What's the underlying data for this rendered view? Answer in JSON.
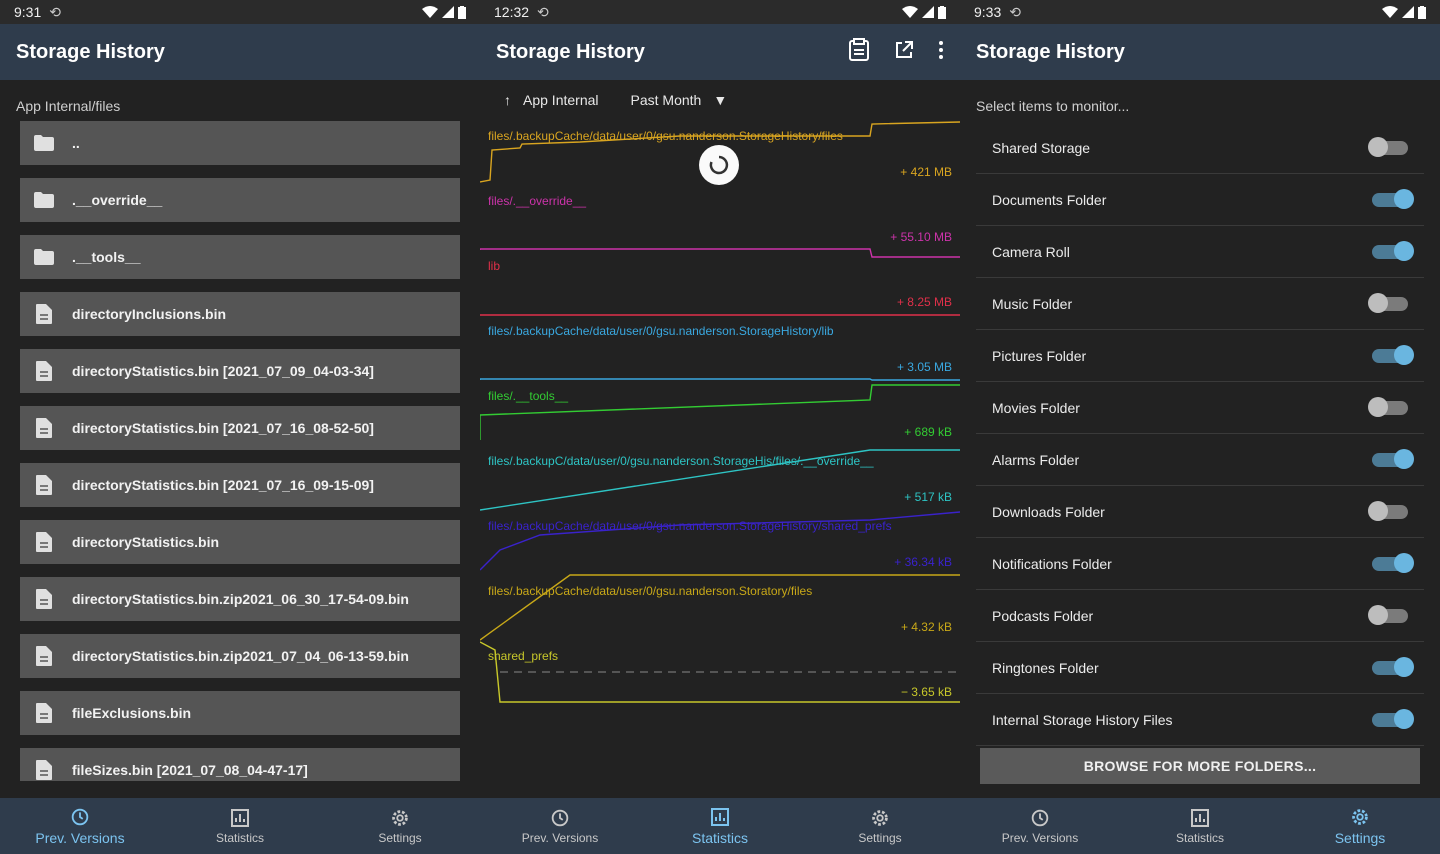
{
  "screen1": {
    "status_time": "9:31",
    "title": "Storage History",
    "path_label": "App Internal/files",
    "items": [
      {
        "name": "..",
        "icon": "folder-icon"
      },
      {
        "name": ".__override__",
        "icon": "folder-icon"
      },
      {
        "name": ".__tools__",
        "icon": "folder-icon"
      },
      {
        "name": "directoryInclusions.bin",
        "icon": "file-icon"
      },
      {
        "name": "directoryStatistics.bin [2021_07_09_04-03-34]",
        "icon": "file-icon"
      },
      {
        "name": "directoryStatistics.bin [2021_07_16_08-52-50]",
        "icon": "file-icon"
      },
      {
        "name": "directoryStatistics.bin [2021_07_16_09-15-09]",
        "icon": "file-icon"
      },
      {
        "name": "directoryStatistics.bin",
        "icon": "file-icon"
      },
      {
        "name": "directoryStatistics.bin.zip2021_06_30_17-54-09.bin",
        "icon": "file-icon"
      },
      {
        "name": "directoryStatistics.bin.zip2021_07_04_06-13-59.bin",
        "icon": "file-icon"
      },
      {
        "name": "fileExclusions.bin",
        "icon": "file-icon"
      },
      {
        "name": "fileSizes.bin [2021_07_08_04-47-17]",
        "icon": "file-icon"
      }
    ]
  },
  "screen2": {
    "status_time": "12:32",
    "title": "Storage History",
    "filter_location": "App Internal",
    "filter_range": "Past Month",
    "charts": [
      {
        "label": "files/.backupCache/data/user/0/gsu.nanderson.StorageHistory/files",
        "delta": "+ 421 MB",
        "color": "#d9a520"
      },
      {
        "label": "files/.__override__",
        "delta": "+ 55.10 MB",
        "color": "#cc33aa"
      },
      {
        "label": "lib",
        "delta": "+ 8.25 MB",
        "color": "#e0304a"
      },
      {
        "label": "files/.backupCache/data/user/0/gsu.nanderson.StorageHistory/lib",
        "delta": "+ 3.05 MB",
        "color": "#3aa8e0"
      },
      {
        "label": "files/.__tools__",
        "delta": "+ 689 kB",
        "color": "#33cc33"
      },
      {
        "label": "files/.backupC/data/user/0/gsu.nanderson.StorageHis/files/.__override__",
        "delta": "+ 517 kB",
        "color": "#2ec4c4"
      },
      {
        "label": "files/.backupCache/data/user/0/gsu.nanderson.StorageHistory/shared_prefs",
        "delta": "+ 36.34 kB",
        "color": "#3a22cc"
      },
      {
        "label": "files/.backupCache/data/user/0/gsu.nanderson.Storatory/files",
        "delta": "+ 4.32 kB",
        "color": "#c8a818"
      },
      {
        "label": "shared_prefs",
        "delta": "− 3.65 kB",
        "color": "#c8c82a"
      }
    ]
  },
  "screen3": {
    "status_time": "9:33",
    "title": "Storage History",
    "prompt": "Select items to monitor...",
    "items": [
      {
        "label": "Shared Storage",
        "on": false
      },
      {
        "label": "Documents Folder",
        "on": true
      },
      {
        "label": "Camera Roll",
        "on": true
      },
      {
        "label": "Music Folder",
        "on": false
      },
      {
        "label": "Pictures Folder",
        "on": true
      },
      {
        "label": "Movies Folder",
        "on": false
      },
      {
        "label": "Alarms Folder",
        "on": true
      },
      {
        "label": "Downloads Folder",
        "on": false
      },
      {
        "label": "Notifications Folder",
        "on": true
      },
      {
        "label": "Podcasts Folder",
        "on": false
      },
      {
        "label": "Ringtones Folder",
        "on": true
      },
      {
        "label": "Internal Storage History Files",
        "on": true
      }
    ],
    "browse_label": "BROWSE FOR MORE FOLDERS..."
  },
  "nav": {
    "prev": "Prev. Versions",
    "stats": "Statistics",
    "settings": "Settings"
  }
}
